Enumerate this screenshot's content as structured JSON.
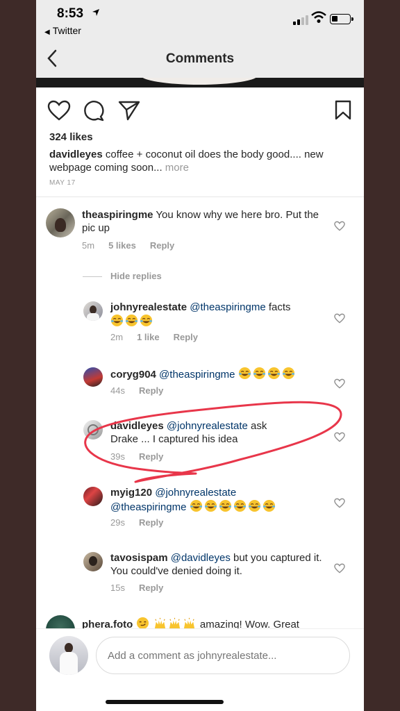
{
  "status_bar": {
    "time": "8:53",
    "back_app": "Twitter"
  },
  "nav": {
    "title": "Comments"
  },
  "post": {
    "likes": "324 likes",
    "author": "davidleyes",
    "caption": " coffee + coconut oil does the body good.... new webpage coming soon...",
    "more": "more",
    "date": "MAY 17"
  },
  "comments": [
    {
      "user": "theaspiringme",
      "text": " You know why we here bro. Put the pic up",
      "time": "5m",
      "likes": "5 likes",
      "reply": "Reply"
    },
    {
      "user": "johnyrealestate",
      "mention": "@theaspiringme",
      "text": " facts",
      "emoji_count": 3,
      "time": "2m",
      "likes": "1 like",
      "reply": "Reply"
    },
    {
      "user": "coryg904",
      "mention": "@theaspiringme",
      "text": "",
      "emoji_count": 4,
      "time": "44s",
      "reply": "Reply"
    },
    {
      "user": "davidleyes",
      "mention": "@johnyrealestate",
      "text": " ask Drake ... I captured his idea",
      "time": "39s",
      "reply": "Reply"
    },
    {
      "user": "myig120",
      "mention": "@johnyrealestate",
      "mention2": "@theaspiringme",
      "emoji_count": 6,
      "time": "29s",
      "reply": "Reply"
    },
    {
      "user": "tavosispam",
      "mention": "@davidleyes",
      "text": " but you captured it. You could've denied doing it.",
      "time": "15s",
      "reply": "Reply"
    },
    {
      "user": "phera.foto",
      "text": " amazing! Wow. Great"
    }
  ],
  "hide_replies": "Hide replies",
  "composer": {
    "placeholder": "Add a comment as johnyrealestate..."
  },
  "icons": [
    "heart-icon",
    "comment-icon",
    "share-icon",
    "bookmark-icon",
    "back-chevron-icon"
  ],
  "colors": {
    "mention": "#003569",
    "annotation": "#e8364a",
    "meta": "#999999"
  }
}
